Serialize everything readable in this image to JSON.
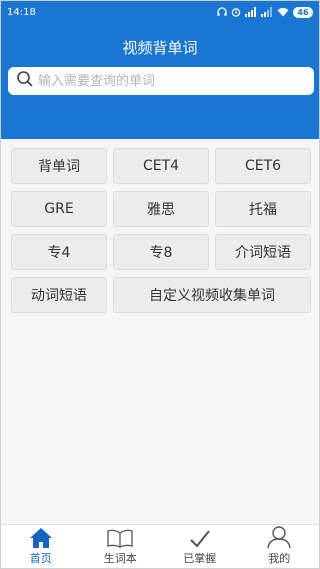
{
  "status_bar": {
    "time": "14:18",
    "battery": "46"
  },
  "header": {
    "title": "视频背单词",
    "search_placeholder": "输入需要查询的单词"
  },
  "categories": [
    "背单词",
    "CET4",
    "CET6",
    "GRE",
    "雅思",
    "托福",
    "专4",
    "专8",
    "介词短语",
    "动词短语",
    "自定义视频收集单词"
  ],
  "bottom_nav": {
    "items": [
      {
        "label": "首页",
        "icon": "home-icon",
        "active": true
      },
      {
        "label": "生词本",
        "icon": "book-icon",
        "active": false
      },
      {
        "label": "已掌握",
        "icon": "check-icon",
        "active": false
      },
      {
        "label": "我的",
        "icon": "user-icon",
        "active": false
      }
    ]
  },
  "colors": {
    "primary": "#1976d2",
    "active_nav": "#1565c0"
  }
}
